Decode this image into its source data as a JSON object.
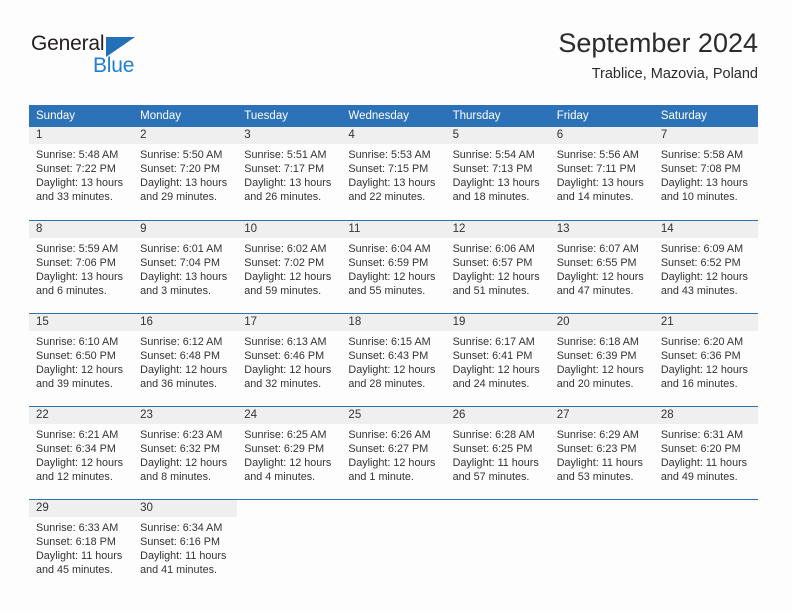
{
  "brand": {
    "name_top": "General",
    "name_bottom": "Blue",
    "accent_color": "#1f7fd0",
    "flag_color": "#2370b8"
  },
  "header": {
    "month_title": "September 2024",
    "location": "Trablice, Mazovia, Poland"
  },
  "theme": {
    "header_row_bg": "#2c72b8",
    "daynum_band_bg": "#efefef",
    "text_color": "#333333",
    "page_bg": "#fdfdfd"
  },
  "weekday_headers": [
    "Sunday",
    "Monday",
    "Tuesday",
    "Wednesday",
    "Thursday",
    "Friday",
    "Saturday"
  ],
  "weeks": [
    [
      {
        "day": "1",
        "sunrise": "Sunrise: 5:48 AM",
        "sunset": "Sunset: 7:22 PM",
        "daylight_1": "Daylight: 13 hours",
        "daylight_2": "and 33 minutes."
      },
      {
        "day": "2",
        "sunrise": "Sunrise: 5:50 AM",
        "sunset": "Sunset: 7:20 PM",
        "daylight_1": "Daylight: 13 hours",
        "daylight_2": "and 29 minutes."
      },
      {
        "day": "3",
        "sunrise": "Sunrise: 5:51 AM",
        "sunset": "Sunset: 7:17 PM",
        "daylight_1": "Daylight: 13 hours",
        "daylight_2": "and 26 minutes."
      },
      {
        "day": "4",
        "sunrise": "Sunrise: 5:53 AM",
        "sunset": "Sunset: 7:15 PM",
        "daylight_1": "Daylight: 13 hours",
        "daylight_2": "and 22 minutes."
      },
      {
        "day": "5",
        "sunrise": "Sunrise: 5:54 AM",
        "sunset": "Sunset: 7:13 PM",
        "daylight_1": "Daylight: 13 hours",
        "daylight_2": "and 18 minutes."
      },
      {
        "day": "6",
        "sunrise": "Sunrise: 5:56 AM",
        "sunset": "Sunset: 7:11 PM",
        "daylight_1": "Daylight: 13 hours",
        "daylight_2": "and 14 minutes."
      },
      {
        "day": "7",
        "sunrise": "Sunrise: 5:58 AM",
        "sunset": "Sunset: 7:08 PM",
        "daylight_1": "Daylight: 13 hours",
        "daylight_2": "and 10 minutes."
      }
    ],
    [
      {
        "day": "8",
        "sunrise": "Sunrise: 5:59 AM",
        "sunset": "Sunset: 7:06 PM",
        "daylight_1": "Daylight: 13 hours",
        "daylight_2": "and 6 minutes."
      },
      {
        "day": "9",
        "sunrise": "Sunrise: 6:01 AM",
        "sunset": "Sunset: 7:04 PM",
        "daylight_1": "Daylight: 13 hours",
        "daylight_2": "and 3 minutes."
      },
      {
        "day": "10",
        "sunrise": "Sunrise: 6:02 AM",
        "sunset": "Sunset: 7:02 PM",
        "daylight_1": "Daylight: 12 hours",
        "daylight_2": "and 59 minutes."
      },
      {
        "day": "11",
        "sunrise": "Sunrise: 6:04 AM",
        "sunset": "Sunset: 6:59 PM",
        "daylight_1": "Daylight: 12 hours",
        "daylight_2": "and 55 minutes."
      },
      {
        "day": "12",
        "sunrise": "Sunrise: 6:06 AM",
        "sunset": "Sunset: 6:57 PM",
        "daylight_1": "Daylight: 12 hours",
        "daylight_2": "and 51 minutes."
      },
      {
        "day": "13",
        "sunrise": "Sunrise: 6:07 AM",
        "sunset": "Sunset: 6:55 PM",
        "daylight_1": "Daylight: 12 hours",
        "daylight_2": "and 47 minutes."
      },
      {
        "day": "14",
        "sunrise": "Sunrise: 6:09 AM",
        "sunset": "Sunset: 6:52 PM",
        "daylight_1": "Daylight: 12 hours",
        "daylight_2": "and 43 minutes."
      }
    ],
    [
      {
        "day": "15",
        "sunrise": "Sunrise: 6:10 AM",
        "sunset": "Sunset: 6:50 PM",
        "daylight_1": "Daylight: 12 hours",
        "daylight_2": "and 39 minutes."
      },
      {
        "day": "16",
        "sunrise": "Sunrise: 6:12 AM",
        "sunset": "Sunset: 6:48 PM",
        "daylight_1": "Daylight: 12 hours",
        "daylight_2": "and 36 minutes."
      },
      {
        "day": "17",
        "sunrise": "Sunrise: 6:13 AM",
        "sunset": "Sunset: 6:46 PM",
        "daylight_1": "Daylight: 12 hours",
        "daylight_2": "and 32 minutes."
      },
      {
        "day": "18",
        "sunrise": "Sunrise: 6:15 AM",
        "sunset": "Sunset: 6:43 PM",
        "daylight_1": "Daylight: 12 hours",
        "daylight_2": "and 28 minutes."
      },
      {
        "day": "19",
        "sunrise": "Sunrise: 6:17 AM",
        "sunset": "Sunset: 6:41 PM",
        "daylight_1": "Daylight: 12 hours",
        "daylight_2": "and 24 minutes."
      },
      {
        "day": "20",
        "sunrise": "Sunrise: 6:18 AM",
        "sunset": "Sunset: 6:39 PM",
        "daylight_1": "Daylight: 12 hours",
        "daylight_2": "and 20 minutes."
      },
      {
        "day": "21",
        "sunrise": "Sunrise: 6:20 AM",
        "sunset": "Sunset: 6:36 PM",
        "daylight_1": "Daylight: 12 hours",
        "daylight_2": "and 16 minutes."
      }
    ],
    [
      {
        "day": "22",
        "sunrise": "Sunrise: 6:21 AM",
        "sunset": "Sunset: 6:34 PM",
        "daylight_1": "Daylight: 12 hours",
        "daylight_2": "and 12 minutes."
      },
      {
        "day": "23",
        "sunrise": "Sunrise: 6:23 AM",
        "sunset": "Sunset: 6:32 PM",
        "daylight_1": "Daylight: 12 hours",
        "daylight_2": "and 8 minutes."
      },
      {
        "day": "24",
        "sunrise": "Sunrise: 6:25 AM",
        "sunset": "Sunset: 6:29 PM",
        "daylight_1": "Daylight: 12 hours",
        "daylight_2": "and 4 minutes."
      },
      {
        "day": "25",
        "sunrise": "Sunrise: 6:26 AM",
        "sunset": "Sunset: 6:27 PM",
        "daylight_1": "Daylight: 12 hours",
        "daylight_2": "and 1 minute."
      },
      {
        "day": "26",
        "sunrise": "Sunrise: 6:28 AM",
        "sunset": "Sunset: 6:25 PM",
        "daylight_1": "Daylight: 11 hours",
        "daylight_2": "and 57 minutes."
      },
      {
        "day": "27",
        "sunrise": "Sunrise: 6:29 AM",
        "sunset": "Sunset: 6:23 PM",
        "daylight_1": "Daylight: 11 hours",
        "daylight_2": "and 53 minutes."
      },
      {
        "day": "28",
        "sunrise": "Sunrise: 6:31 AM",
        "sunset": "Sunset: 6:20 PM",
        "daylight_1": "Daylight: 11 hours",
        "daylight_2": "and 49 minutes."
      }
    ],
    [
      {
        "day": "29",
        "sunrise": "Sunrise: 6:33 AM",
        "sunset": "Sunset: 6:18 PM",
        "daylight_1": "Daylight: 11 hours",
        "daylight_2": "and 45 minutes."
      },
      {
        "day": "30",
        "sunrise": "Sunrise: 6:34 AM",
        "sunset": "Sunset: 6:16 PM",
        "daylight_1": "Daylight: 11 hours",
        "daylight_2": "and 41 minutes."
      },
      {
        "day": "",
        "sunrise": "",
        "sunset": "",
        "daylight_1": "",
        "daylight_2": ""
      },
      {
        "day": "",
        "sunrise": "",
        "sunset": "",
        "daylight_1": "",
        "daylight_2": ""
      },
      {
        "day": "",
        "sunrise": "",
        "sunset": "",
        "daylight_1": "",
        "daylight_2": ""
      },
      {
        "day": "",
        "sunrise": "",
        "sunset": "",
        "daylight_1": "",
        "daylight_2": ""
      },
      {
        "day": "",
        "sunrise": "",
        "sunset": "",
        "daylight_1": "",
        "daylight_2": ""
      }
    ]
  ]
}
